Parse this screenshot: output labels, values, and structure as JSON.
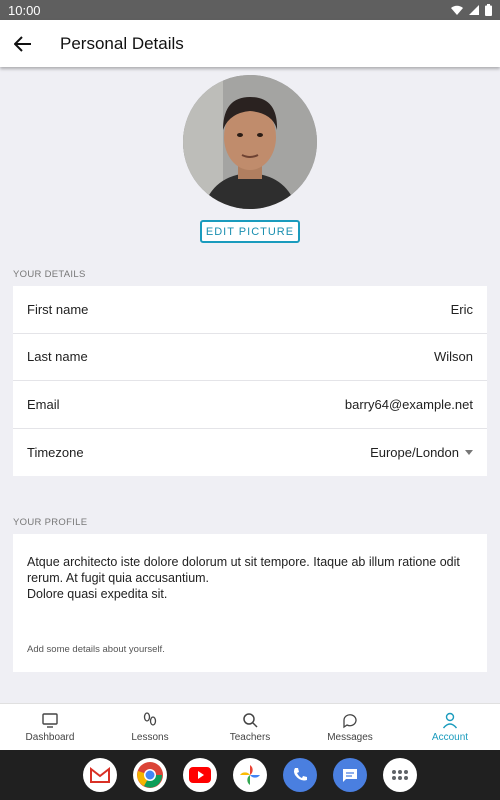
{
  "status_bar": {
    "time": "10:00"
  },
  "app_bar": {
    "title": "Personal Details"
  },
  "avatar": {
    "button_label": "EDIT PICTURE"
  },
  "details": {
    "section_label": "YOUR DETAILS",
    "rows": [
      {
        "label": "First name",
        "value": "Eric"
      },
      {
        "label": "Last name",
        "value": "Wilson"
      },
      {
        "label": "Email",
        "value": "barry64@example.net"
      },
      {
        "label": "Timezone",
        "value": "Europe/London"
      }
    ]
  },
  "profile": {
    "section_label": "YOUR PROFILE",
    "text": "Atque architecto iste dolore dolorum ut sit tempore. Itaque ab illum ratione odit rerum. At fugit quia accusantium.\nDolore quasi expedita sit.",
    "hint": "Add some details about yourself."
  },
  "bottom_nav": {
    "items": [
      {
        "label": "Dashboard",
        "icon": "monitor-icon"
      },
      {
        "label": "Lessons",
        "icon": "footsteps-icon"
      },
      {
        "label": "Teachers",
        "icon": "search-icon"
      },
      {
        "label": "Messages",
        "icon": "chat-bubbles-icon"
      },
      {
        "label": "Account",
        "icon": "person-icon",
        "active": true
      }
    ]
  },
  "dock": {
    "apps": [
      "gmail-icon",
      "chrome-icon",
      "youtube-icon",
      "photos-icon",
      "phone-icon",
      "messages-app-icon",
      "app-drawer-icon"
    ]
  },
  "colors": {
    "accent": "#1a9bbd",
    "background": "#efeff4"
  }
}
